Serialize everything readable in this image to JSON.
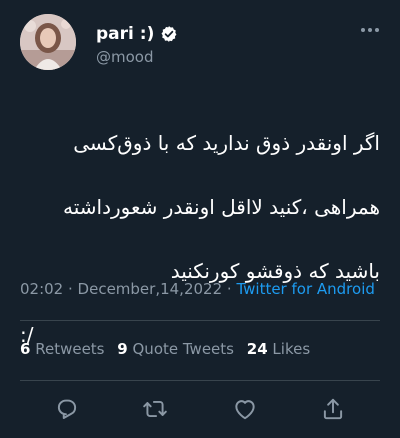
{
  "user": {
    "display_name": "pari :)",
    "handle": "@mood"
  },
  "tweet": {
    "lines": [
      "اگر اونقدر ذوق ندارید که با ذوق‌کسی",
      "همراهی ،کنید لااقل اونقدر شعورداشته",
      "باشید که ذوقشو کورنکنید",
      ":/"
    ]
  },
  "meta": {
    "time": "02:02",
    "separator": " · ",
    "date": "December,14,2022",
    "source": "Twitter for Android"
  },
  "stats": {
    "retweets_count": "6",
    "retweets_label": "Retweets",
    "quotes_count": "9",
    "quotes_label": "Quote Tweets",
    "likes_count": "24",
    "likes_label": "Likes"
  },
  "actions": {
    "reply_icon": "reply-icon",
    "retweet_icon": "retweet-icon",
    "like_icon": "heart-icon",
    "share_icon": "share-icon"
  },
  "colors": {
    "background": "#15202b",
    "text": "#ffffff",
    "secondary": "#8b98a5",
    "accent": "#1d9bf0",
    "divider": "#38444d"
  }
}
